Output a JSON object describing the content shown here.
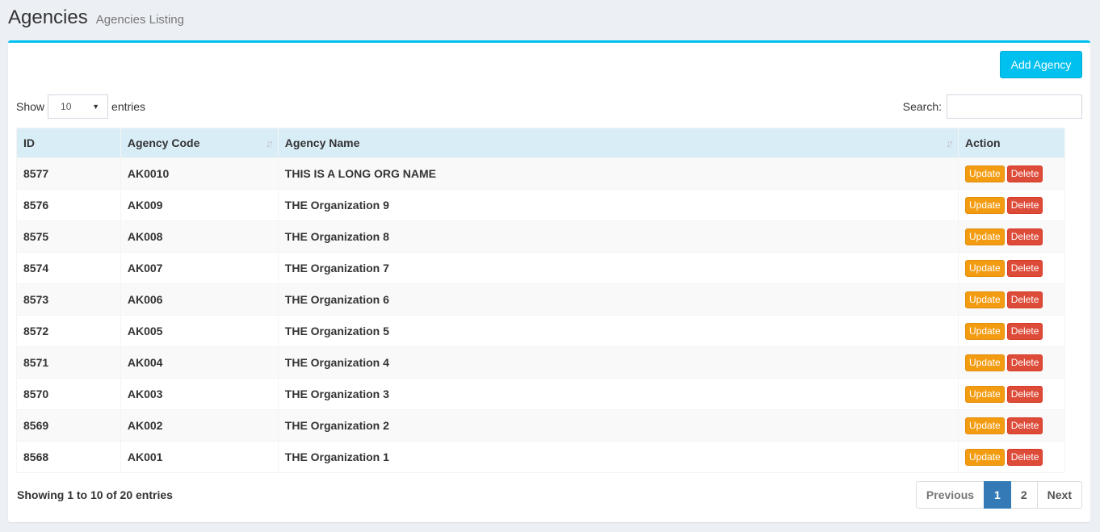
{
  "header": {
    "title": "Agencies",
    "subtitle": "Agencies Listing"
  },
  "toolbar": {
    "add_label": "Add Agency"
  },
  "length": {
    "show_label": "Show",
    "value": "10",
    "entries_label": "entries"
  },
  "search": {
    "label": "Search:",
    "value": ""
  },
  "table": {
    "columns": [
      "ID",
      "Agency Code",
      "Agency Name",
      "Action"
    ],
    "rows": [
      {
        "id": "8577",
        "code": "AK0010",
        "name": "THIS IS A LONG ORG NAME"
      },
      {
        "id": "8576",
        "code": "AK009",
        "name": "THE Organization 9"
      },
      {
        "id": "8575",
        "code": "AK008",
        "name": "THE Organization 8"
      },
      {
        "id": "8574",
        "code": "AK007",
        "name": "THE Organization 7"
      },
      {
        "id": "8573",
        "code": "AK006",
        "name": "THE Organization 6"
      },
      {
        "id": "8572",
        "code": "AK005",
        "name": "THE Organization 5"
      },
      {
        "id": "8571",
        "code": "AK004",
        "name": "THE Organization 4"
      },
      {
        "id": "8570",
        "code": "AK003",
        "name": "THE Organization 3"
      },
      {
        "id": "8569",
        "code": "AK002",
        "name": "THE Organization 2"
      },
      {
        "id": "8568",
        "code": "AK001",
        "name": "THE Organization 1"
      }
    ],
    "update_label": "Update",
    "delete_label": "Delete"
  },
  "footer": {
    "info": "Showing 1 to 10 of 20 entries",
    "previous": "Previous",
    "pages": [
      "1",
      "2"
    ],
    "next": "Next"
  },
  "colors": {
    "accent": "#00c0ef",
    "update": "#f39c12",
    "delete": "#dd4b39",
    "active_page": "#337ab7",
    "header_bg": "#d9edf7"
  }
}
